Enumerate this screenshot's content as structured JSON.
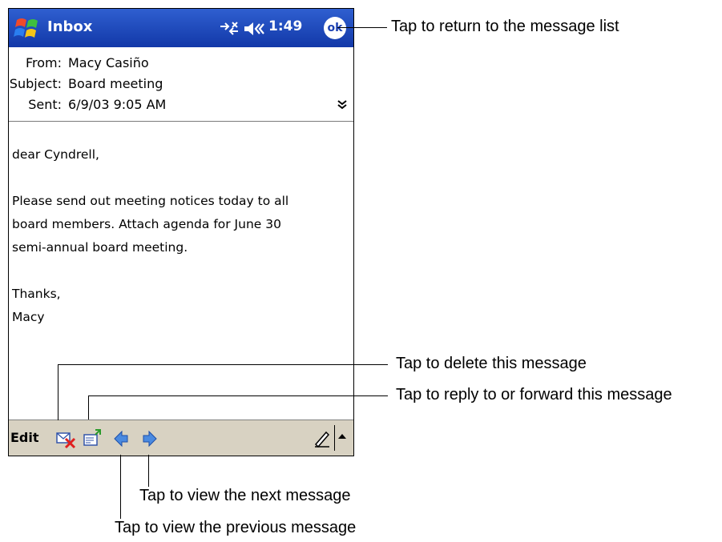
{
  "titlebar": {
    "app_title": "Inbox",
    "clock": "1:49",
    "ok_label": "ok",
    "color": "#1a47c4"
  },
  "message": {
    "from_label": "From:",
    "from_value": "Macy Casiño",
    "subject_label": "Subject:",
    "subject_value": "Board meeting",
    "sent_label": "Sent:",
    "sent_value": "6/9/03  9:05 AM",
    "body_lines": [
      "dear Cyndrell,",
      "",
      "Please send out meeting notices today to all",
      "board members. Attach agenda for June 30",
      "semi-annual board meeting.",
      "",
      "Thanks,",
      "Macy"
    ]
  },
  "toolbar": {
    "edit_label": "Edit",
    "background": "#d8d2c2"
  },
  "callouts": {
    "ok": "Tap to return to the message list",
    "delete": "Tap to delete this message",
    "reply": "Tap to reply to or forward this message",
    "next": "Tap to view the next message",
    "previous": "Tap to view the previous message"
  },
  "icons": {
    "start": "windows-flag-icon",
    "connection": "connection-icon",
    "volume": "speaker-icon",
    "expand": "double-chevron-down-icon",
    "delete": "delete-message-icon",
    "reply": "reply-forward-icon",
    "previous": "previous-arrow-icon",
    "next": "next-arrow-icon",
    "pen": "pen-icon",
    "sip": "input-panel-arrow-icon"
  }
}
